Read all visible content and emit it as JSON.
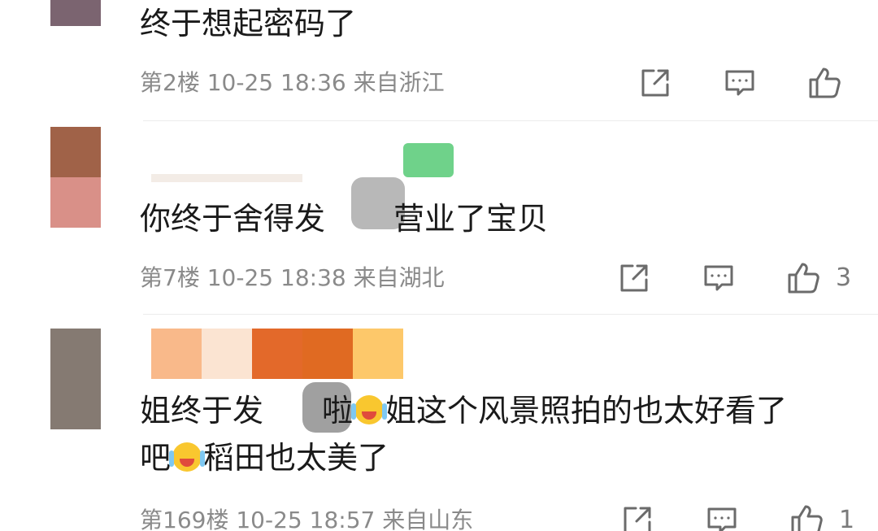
{
  "comments": [
    {
      "text": "终于想起密码了",
      "floor": "第2楼",
      "date": "10-25",
      "time": "18:36",
      "location": "来自浙江",
      "likes": ""
    },
    {
      "text_before": "你终于舍得发",
      "text_after": "营业了宝贝",
      "floor": "第7楼",
      "date": "10-25",
      "time": "18:38",
      "location": "来自湖北",
      "likes": "3"
    },
    {
      "line1_a": "姐终于发",
      "line1_b": "啦",
      "line1_c": "姐这个风景照拍的也太好看了",
      "line2_a": "吧",
      "line2_b": "稻田也太美了",
      "floor": "第169楼",
      "date": "10-25",
      "time": "18:57",
      "location": "来自山东",
      "likes": "1"
    }
  ],
  "icons": {
    "share": "share-icon",
    "reply": "comment-icon",
    "like": "thumbs-up-icon",
    "emoji": "crying-laughing-emoji-icon"
  },
  "colors": {
    "text": "#1a1a1a",
    "meta": "#8a8a8a",
    "icon": "#6b6b6b"
  }
}
